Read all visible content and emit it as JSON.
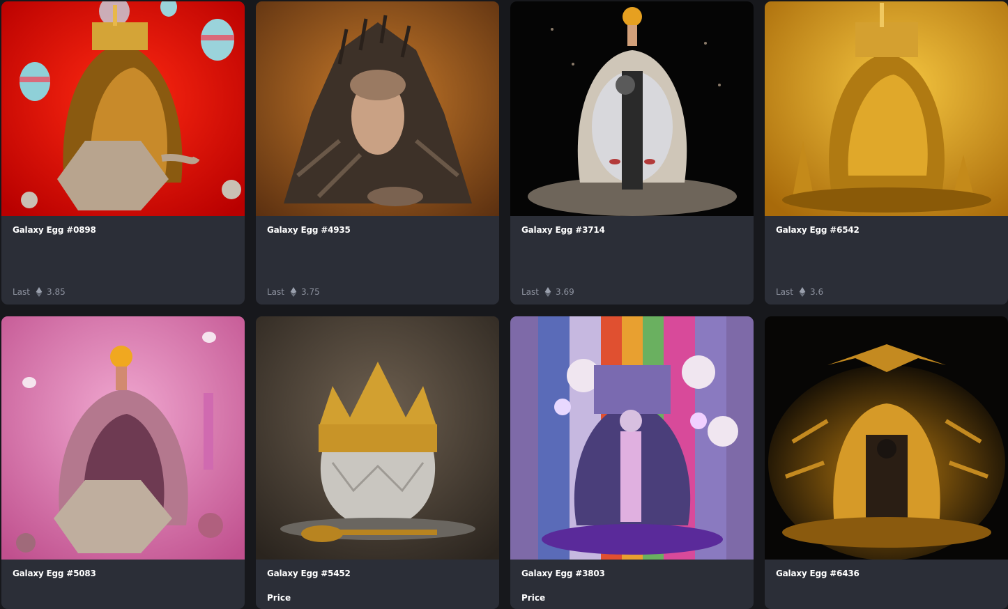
{
  "cards": [
    {
      "title": "Galaxy Egg #0898",
      "last_label": "Last",
      "last_value": "3.85",
      "art": "red-teapot-egg"
    },
    {
      "title": "Galaxy Egg #4935",
      "last_label": "Last",
      "last_value": "3.75",
      "art": "bronze-face-throne"
    },
    {
      "title": "Galaxy Egg #3714",
      "last_label": "Last",
      "last_value": "3.69",
      "art": "split-face-egg"
    },
    {
      "title": "Galaxy Egg #6542",
      "last_label": "Last",
      "last_value": "3.6",
      "art": "gold-castle-egg"
    },
    {
      "title": "Galaxy Egg #5083",
      "art": "pink-teapot-egg"
    },
    {
      "title": "Galaxy Egg #5452",
      "price_label": "Price",
      "art": "crown-egg"
    },
    {
      "title": "Galaxy Egg #3803",
      "price_label": "Price",
      "art": "rainbow-figure-egg"
    },
    {
      "title": "Galaxy Egg #6436",
      "art": "dragon-gold-egg"
    }
  ],
  "icons": {
    "currency": "ethereum-icon"
  },
  "colors": {
    "page_bg": "#17181c",
    "card_bg": "#2b2e37",
    "title": "#ffffff",
    "muted": "#8e93a0"
  }
}
